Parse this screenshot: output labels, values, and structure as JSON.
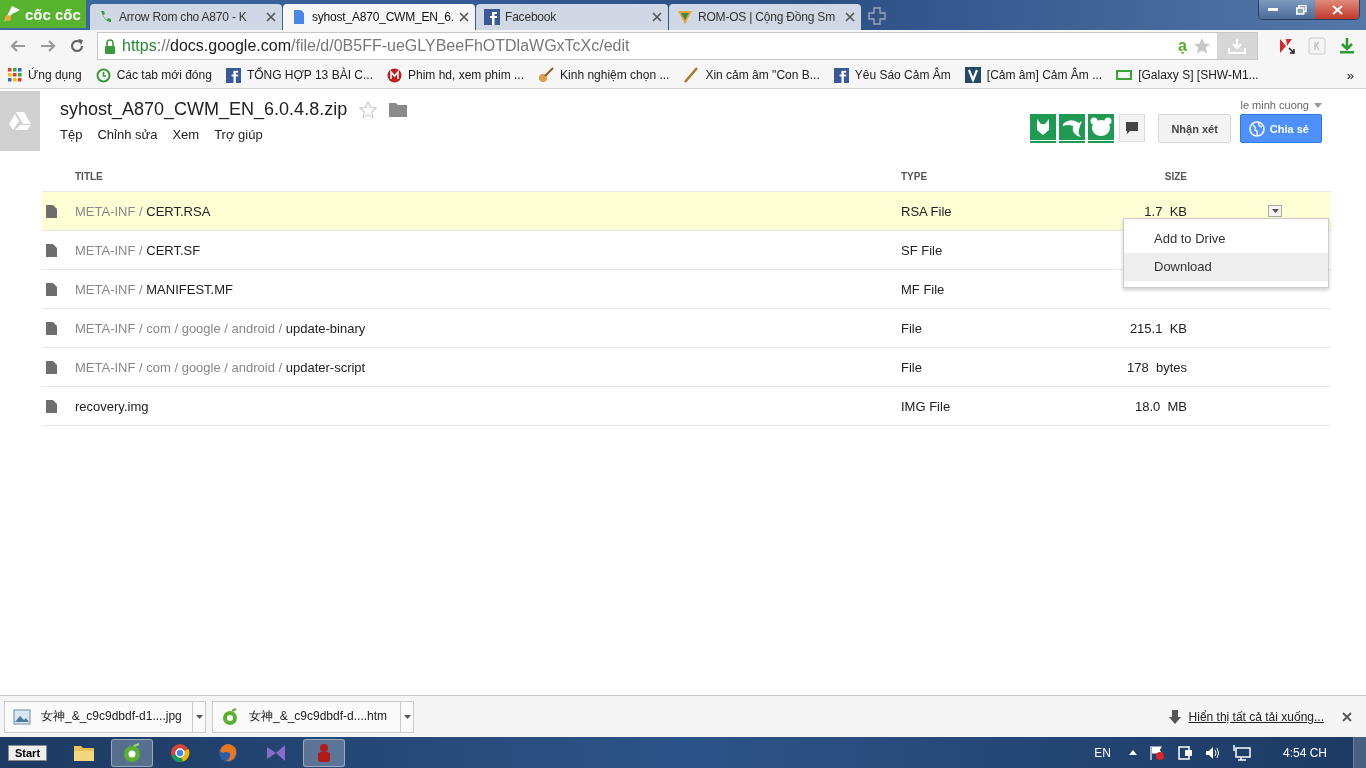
{
  "browser": {
    "logo": "cốc cốc",
    "tabs": [
      {
        "title": "Arrow Rom cho A870 - K",
        "kind": "phone",
        "selected": false
      },
      {
        "title": "syhost_A870_CWM_EN_6.",
        "kind": "doc",
        "selected": true
      },
      {
        "title": "Facebook",
        "kind": "facebook",
        "selected": false
      },
      {
        "title": "ROM-OS | Cộng Đồng Sm",
        "kind": "shield",
        "selected": false
      }
    ],
    "url_parts": [
      {
        "text": "https",
        "kind": "scheme"
      },
      {
        "text": "://",
        "kind": "dim"
      },
      {
        "text": "docs.google.com",
        "kind": "host"
      },
      {
        "text": "/file/d/0B5FF-ueGLYBeeFhOTDlaWGxTcXc/edit",
        "kind": "dim"
      }
    ],
    "address_badge": "ạ",
    "bookmarks": [
      {
        "label": "Ứng dụng",
        "kind": "grid"
      },
      {
        "label": "Các tab mới đóng",
        "kind": "clock"
      },
      {
        "label": "TỔNG HỢP 13 BÀI C...",
        "kind": "facebook"
      },
      {
        "label": "Phim hd, xem phim ...",
        "kind": "m"
      },
      {
        "label": "Kinh nghiệm chọn ...",
        "kind": "guitar"
      },
      {
        "label": "Xin cảm âm \"Con B...",
        "kind": "flute"
      },
      {
        "label": "Yêu Sáo Cảm Âm",
        "kind": "facebook"
      },
      {
        "label": "[Cảm âm] Cảm Âm ...",
        "kind": "v"
      },
      {
        "label": "[Galaxy S] [SHW-M1...",
        "kind": "bar"
      }
    ],
    "bookmarks_more": "»"
  },
  "doc": {
    "title": "syhost_A870_CWM_EN_6.0.4.8.zip",
    "menu": [
      "Tệp",
      "Chỉnh sửa",
      "Xem",
      "Trợ giúp"
    ],
    "user": "le minh cuong",
    "comment_button": "Nhận xét",
    "share_button": "Chia sẻ"
  },
  "table": {
    "columns": [
      "TITLE",
      "TYPE",
      "SIZE"
    ],
    "rows": [
      {
        "prefix": "META-INF / ",
        "name": "CERT.RSA",
        "type": "RSA File",
        "size": "1.7  KB",
        "selected": true
      },
      {
        "prefix": "META-INF / ",
        "name": "CERT.SF",
        "type": "SF File",
        "selected": false
      },
      {
        "prefix": "META-INF / ",
        "name": "MANIFEST.MF",
        "type": "MF File",
        "selected": false
      },
      {
        "prefix": "META-INF / com / google / android / ",
        "name": "update-binary",
        "type": "File",
        "size": "215.1  KB",
        "selected": false
      },
      {
        "prefix": "META-INF / com / google / android / ",
        "name": "updater-script",
        "type": "File",
        "size": "178  bytes",
        "selected": false
      },
      {
        "prefix": "",
        "name": "recovery.img",
        "type": "IMG File",
        "size": "18.0  MB",
        "selected": false
      }
    ]
  },
  "context_menu": {
    "items": [
      {
        "label": "Add to Drive",
        "selected": false
      },
      {
        "label": "Download",
        "selected": true
      }
    ]
  },
  "downloads": {
    "items": [
      {
        "name": "女神_&_c9c9dbdf-d1....jpg",
        "kind": "image"
      },
      {
        "name": "女神_&_c9c9dbdf-d....htm",
        "kind": "coccoc"
      }
    ],
    "show_all": "Hiển thị tất cả tải xuống..."
  },
  "taskbar": {
    "start": "Start",
    "apps": [
      {
        "kind": "folder",
        "active": false
      },
      {
        "kind": "coccoc",
        "active": true
      },
      {
        "kind": "chrome",
        "active": false
      },
      {
        "kind": "firefox",
        "active": false
      },
      {
        "kind": "vs",
        "active": false
      },
      {
        "kind": "red",
        "active": true
      }
    ],
    "language": "EN",
    "time": "4:54 CH"
  }
}
